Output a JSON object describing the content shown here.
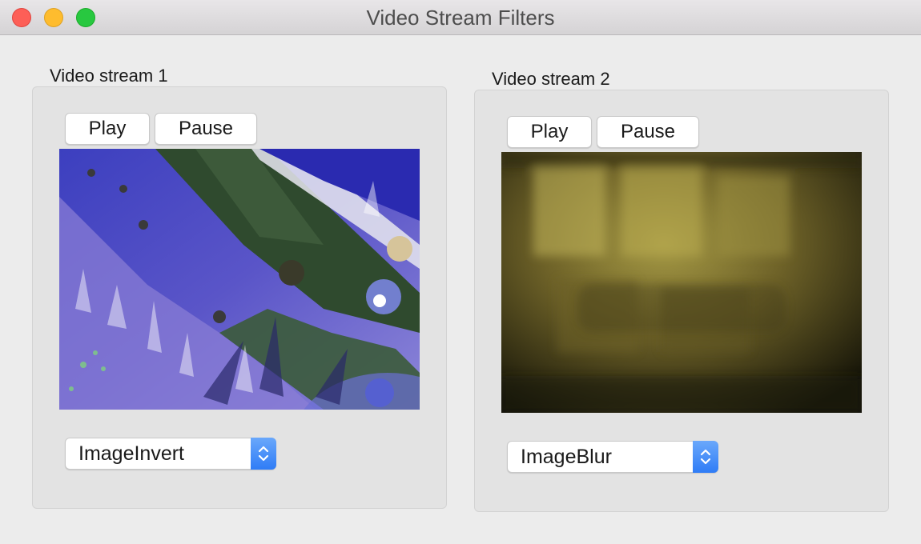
{
  "window": {
    "title": "Video Stream Filters"
  },
  "streams": [
    {
      "label": "Video stream 1",
      "play_label": "Play",
      "pause_label": "Pause",
      "filter": "ImageInvert"
    },
    {
      "label": "Video stream 2",
      "play_label": "Play",
      "pause_label": "Pause",
      "filter": "ImageBlur"
    }
  ],
  "colors": {
    "close": "#fd5f57",
    "minimize": "#febc2e",
    "maximize": "#28c840",
    "accent": "#2f7cf6"
  }
}
